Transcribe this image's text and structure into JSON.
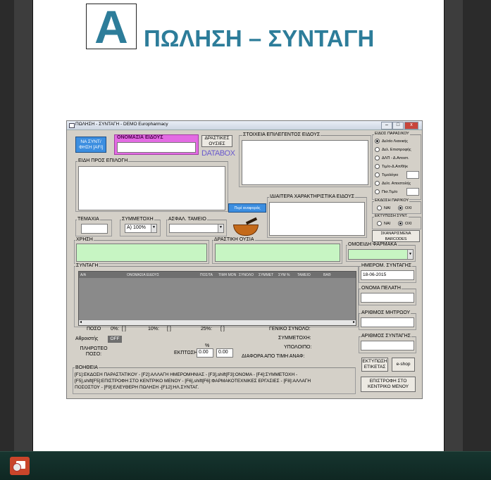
{
  "document": {
    "letter": "A",
    "title": "ΠΩΛΗΣΗ – ΣΥΝΤΑΓΗ"
  },
  "window": {
    "title": "ΠΩΛΗΣΗ - ΣΥΝΤΑΓΗ - DEMO Europharmacy",
    "controls": {
      "minimize": "–",
      "maximize": "□",
      "close": "x"
    }
  },
  "top": {
    "afi_button": "ΝΑ ΣΥΝΤ/ΦΗΣΗ [AFI]",
    "product_name_label": "ΟΝΟΜΑΣΙΑ ΕΙΔΟΥΣ",
    "active_substances_button": "ΔΡΑΣΤΙΚΕΣ ΟΥΣΙΕΣ",
    "databox_logo": "DATABOX",
    "selected_item_details_label": "ΣΤΟΙΧΕΙΑ ΕΠΙΛΕΓΕΝΤΟΣ ΕΙΔΟΥΣ",
    "items_for_selection_label": "ΕΙΔΗ ΠΡΟΣ ΕΠΙΛΟΓΗ",
    "about_reference_button": "Περί αναφοράς",
    "special_features_label": "ΙΔΙΑΙΤΕΡΑ ΧΑΡΑΚΤΗΡΙΣΤΙΚΑ ΕΙΔΟΥΣ"
  },
  "doc_type": {
    "label": "ΕΙΔΟΣ ΠΑΡΑΣ/ΚΟΥ",
    "options": [
      "Δελτίο Λιανικής",
      "Δελ. Επιστροφής",
      "ΔΛΠ - Δ.Αποστ.",
      "Τιμ/ο-Δ.Απ/θήκ",
      "Τιμολόγιο",
      "Δελτ. Αποστολής",
      "Πισ.Τιμ/ο"
    ],
    "selected": 0
  },
  "issue_receipt": {
    "label": "ΕΚΔΟΣΗ ΠΑΡ/ΚΟΥ",
    "yes": "ΝΑΙ",
    "no": "ΟΧΙ"
  },
  "print_rx": {
    "label": "ΕΚΤΥΠΩΣΗ ΣΥΝΤ.",
    "yes": "ΝΑΙ",
    "no": "ΟΧΙ"
  },
  "scanned_barcodes_button": "ΣΚΑΝΑΡΙΣΜΕΝΑ BARCODES",
  "mid": {
    "pieces_label": "ΤΕΜΑΧΙΑ",
    "participation_label": "ΣΥΜΜΕΤΟΧΗ",
    "participation_value": "Α) 100%",
    "fund_label": "ΑΣΦΑΛ. ΤΑΜΕΙΟ",
    "usage_label": "ΧΡΗΣΗ",
    "active_substance_label": "ΔΡΑΣΤΙΚΗ ΟΥΣΙΑ",
    "similar_drugs_label": "ΟΜΟΕΙΔΗ ΦΑΡΜΑΚΑ"
  },
  "prescription": {
    "label": "ΣΥΝΤΑΓΗ",
    "columns": [
      "A/A",
      "ΟΝΟΜΑΣΙΑ ΕΙΔΟΥΣ",
      "ΠΟΣ/ΤΑ",
      "ΤΙΜΗ ΜΟΝ",
      "ΣΥΝΟΛΟ",
      "ΣΥΜΜΕΤ",
      "ΣΥΜ %",
      "ΤΑΜΕΙΟ",
      "ΒΑΘ"
    ]
  },
  "right_fields": {
    "rx_date_label": "ΗΜΕΡΟΜ. ΣΥΝΤΑΓΗΣ",
    "rx_date_value": "18-06-2015",
    "customer_label": "ΟΝΟΜΑ ΠΕΛΑΤΗ",
    "registry_label": "ΑΡΙΘΜΟΣ ΜΗΤΡΩΟΥ",
    "rx_number_label": "ΑΡΙΘΜΟΣ ΣΥΝΤΑΓΗΣ",
    "print_labels_button": "ΕΚΤΥΠΩΣΗ ΕΤΙΚΕΤΑΣ",
    "eshop_button": "e-shop",
    "back_button": "ΕΠΙΣΤΡΟΦΗ ΣΤΟ ΚΕΝΤΡΙΚΟ ΜΕΝΟΥ"
  },
  "totals": {
    "amount_label": "ΠΟΣΟ",
    "p0": "0%:",
    "p10": "10%:",
    "p25": "25%:",
    "bracket": "[ ]",
    "cumulative_label": "Αθροιστής",
    "cumulative_toggle": "OFF",
    "payable_label": "ΠΛΗΡΩΤΕΟ ΠΟΣΟ:",
    "discount_label": "ΕΚΠΤΩΣΗ:",
    "percent_sign": "%",
    "discount_pct": "0.00",
    "discount_amt": "0.00",
    "grand_total_label": "ΓΕΝΙΚΟ ΣΥΝΟΛΟ:",
    "participation_total_label": "ΣΥΜΜΕΤΟΧΗ:",
    "remainder_label": "ΥΠΟΛΟΙΠΟ:",
    "diff_label": "ΔΙΑΦΟΡΑ ΑΠΟ ΤΙΜΗ ΑΝΑΦ:"
  },
  "help": {
    "label": "ΒΟΗΘΕΙΑ",
    "line1": "[F1]:ΕΚΔΟΣΗ ΠΑΡΑΣΤΑΤΙΚΟΥ - [F2]:ΑΛΛΑΓΗ ΗΜΕΡΟΜΗΝΙΑΣ - [F3],shift[F3]:ΟΝΟΜΑ - [F4]:ΣΥΜΜΕΤΟΧΗ -",
    "line2": "[F5],shift[F5]:ΕΠΙΣΤΡΟΦΗ ΣΤΟ ΚΕΝΤΡΙΚΟ ΜΕΝΟΥ - [F6],shift[F6]:ΦΑΡΜΑΚΟΤΕΧΝΙΚΕΣ ΕΡΓΑΣΙΕΣ - [F8]:ΑΛΛΑΓΗ",
    "line3": "ΠΟΣΟΣΤΟΥ - [F9]:ΕΛΕΥΘΕΡΗ ΠΩΛΗΣΗ -[F12]:ΗΛ.ΣΥΝΤΑΓ."
  },
  "colors": {
    "doc_title": "#2d7d9a",
    "afi_button": "#3c8ee0",
    "product_name_border": "#e36be3",
    "green_field": "#c7f5c3",
    "taskbar": "#16352f"
  }
}
